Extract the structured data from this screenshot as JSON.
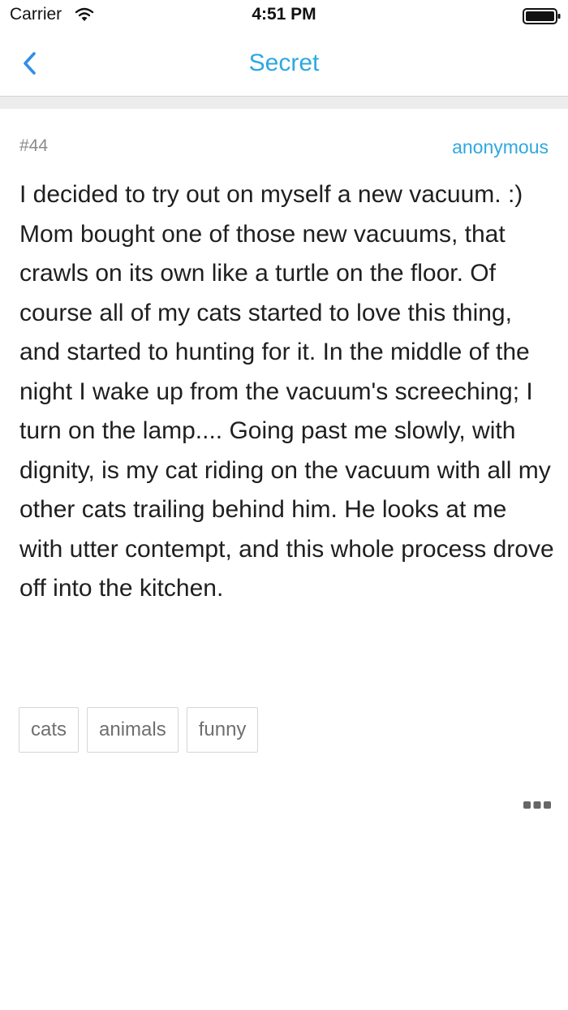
{
  "status_bar": {
    "carrier": "Carrier",
    "time": "4:51 PM",
    "wifi_icon": "wifi-icon",
    "battery_icon": "battery-full-icon"
  },
  "nav": {
    "title": "Secret",
    "back_icon": "chevron-left-icon",
    "accent_color": "#2ea8e0"
  },
  "secret": {
    "number": "#44",
    "author": "anonymous",
    "body": "I decided to try out on myself a new vacuum. :) Mom bought one of those new vacuums, that crawls on its own like a turtle on the floor. Of course all of my cats started to love this thing, and started to hunting for it. In the middle of the night I wake up from the vacuum's screeching; I turn on the lamp.... Going past me slowly, with dignity,  is my cat riding on the vacuum with all my other cats trailing behind him. He looks at me with utter contempt, and this whole process drove off into the kitchen.",
    "tags": [
      {
        "label": "cats"
      },
      {
        "label": "animals"
      },
      {
        "label": "funny"
      }
    ],
    "more_icon": "more-dots-icon"
  }
}
